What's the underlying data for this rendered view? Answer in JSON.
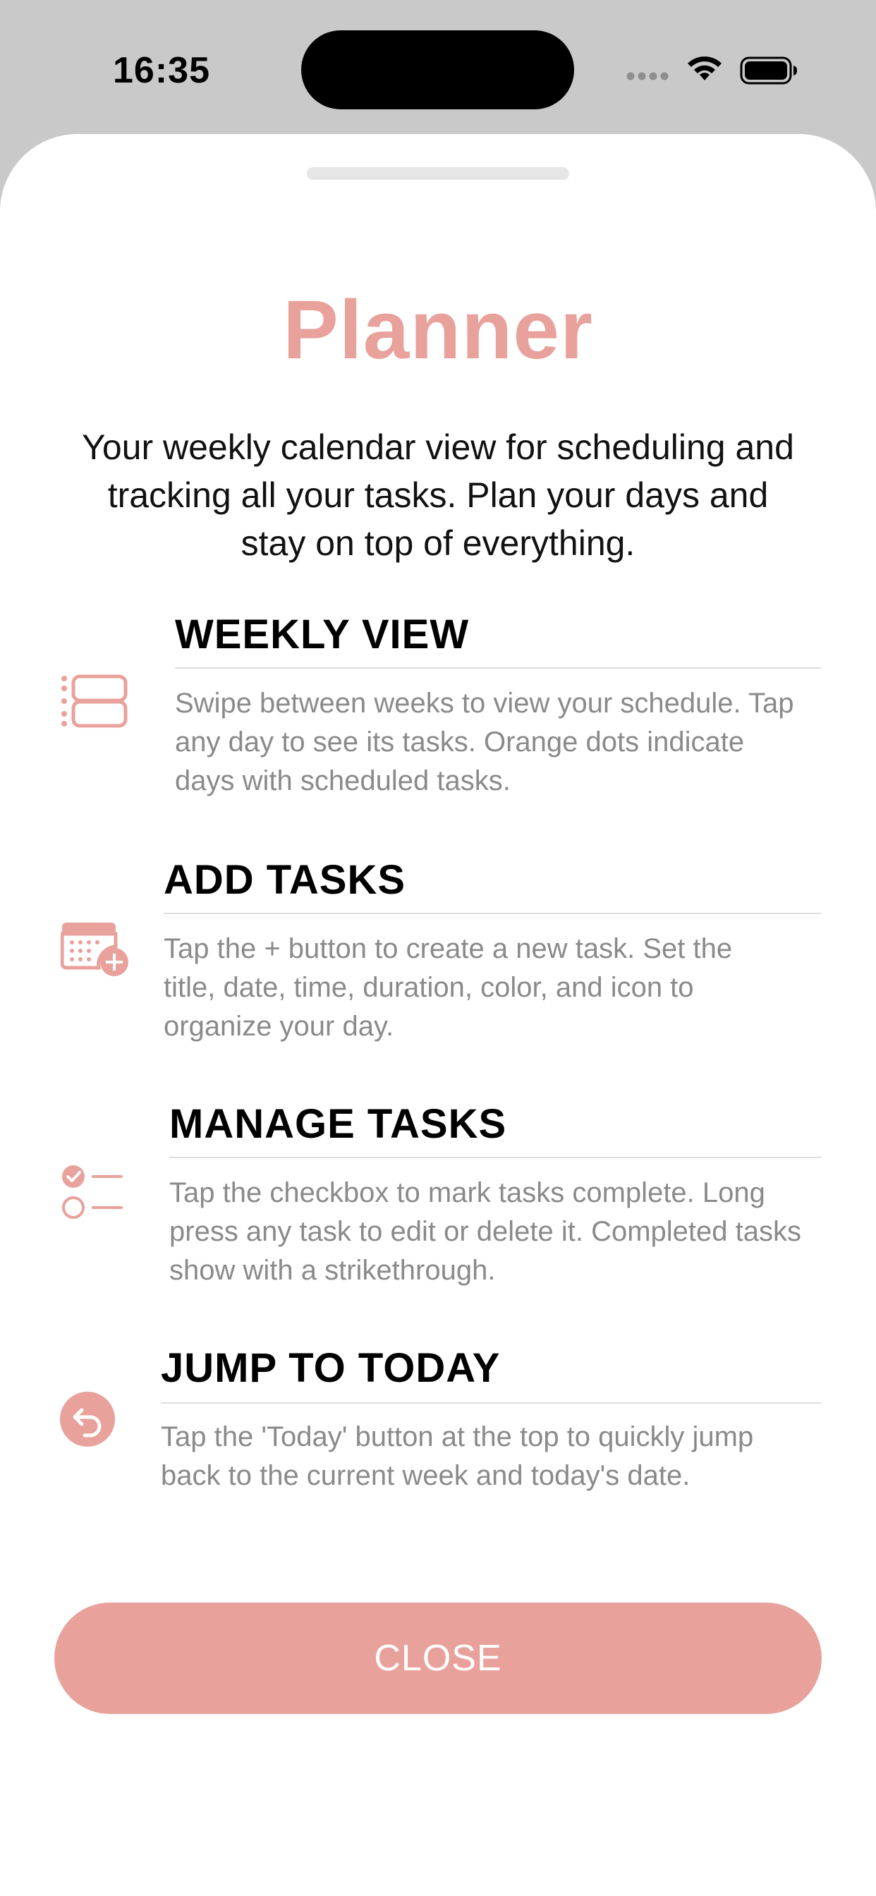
{
  "status_bar": {
    "time": "16:35"
  },
  "sheet": {
    "title": "Planner",
    "subtitle": "Your weekly calendar view for scheduling and tracking all your tasks. Plan your days and stay on top of everything."
  },
  "features": [
    {
      "heading": "WEEKLY VIEW",
      "description": "Swipe between weeks to view your schedule. Tap any day to see its tasks. Orange dots indicate days with scheduled tasks.",
      "icon": "list-rectangles-icon"
    },
    {
      "heading": "ADD TASKS",
      "description": "Tap the + button to create a new task. Set the title, date, time, duration, color, and icon to organize your day.",
      "icon": "calendar-plus-icon"
    },
    {
      "heading": "MANAGE TASKS",
      "description": "Tap the checkbox to mark tasks complete. Long press any task to edit or delete it. Completed tasks show with a strikethrough.",
      "icon": "checklist-icon"
    },
    {
      "heading": "JUMP TO TODAY",
      "description": "Tap the 'Today' button at the top to quickly jump back to the current week and today's date.",
      "icon": "return-arrow-circle-icon"
    }
  ],
  "close_button": {
    "label": "CLOSE"
  },
  "colors": {
    "accent": "#e8a19b",
    "background": "#c9c9c9",
    "sheet": "#ffffff",
    "heading": "#000000",
    "description": "#8a8a8a"
  }
}
